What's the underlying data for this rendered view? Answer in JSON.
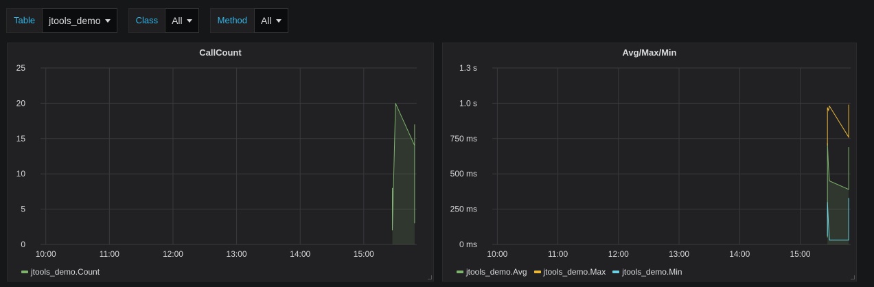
{
  "variables": [
    {
      "label": "Table",
      "value": "jtools_demo"
    },
    {
      "label": "Class",
      "value": "All"
    },
    {
      "label": "Method",
      "value": "All"
    }
  ],
  "colors": {
    "avg": "#7eb26d",
    "max": "#eab839",
    "min": "#6ed0e0",
    "grid": "#3a3a3d"
  },
  "chart_data": [
    {
      "type": "line",
      "title": "CallCount",
      "xticks": [
        "10:00",
        "11:00",
        "12:00",
        "13:00",
        "14:00",
        "15:00"
      ],
      "yticks": [
        "0",
        "5",
        "10",
        "15",
        "20",
        "25"
      ],
      "ylim": [
        0,
        25
      ],
      "xlim": [
        "09:55",
        "15:50"
      ],
      "grid": true,
      "legend_position": "bottom-left",
      "series": [
        {
          "name": "jtools_demo.Count",
          "color": "#7eb26d",
          "fill": true,
          "x": [
            "15:27",
            "15:27",
            "15:30",
            "15:48",
            "15:48",
            "15:48"
          ],
          "values": [
            8,
            2,
            20,
            14,
            3,
            17
          ]
        }
      ]
    },
    {
      "type": "line",
      "title": "Avg/Max/Min",
      "xticks": [
        "10:00",
        "11:00",
        "12:00",
        "13:00",
        "14:00",
        "15:00"
      ],
      "yticks": [
        "0 ms",
        "250 ms",
        "500 ms",
        "750 ms",
        "1.0 s",
        "1.3 s"
      ],
      "ylim": [
        0,
        1.25
      ],
      "xlim": [
        "09:55",
        "15:50"
      ],
      "grid": true,
      "legend_position": "bottom-left",
      "series": [
        {
          "name": "jtools_demo.Avg",
          "color": "#7eb26d",
          "fill": true,
          "x": [
            "15:27",
            "15:27",
            "15:28",
            "15:29",
            "15:48",
            "15:48"
          ],
          "values": [
            0.05,
            0.72,
            0.55,
            0.45,
            0.39,
            0.69
          ]
        },
        {
          "name": "jtools_demo.Max",
          "color": "#eab839",
          "fill": false,
          "x": [
            "15:27",
            "15:27",
            "15:28",
            "15:29",
            "15:48",
            "15:48"
          ],
          "values": [
            0.7,
            0.97,
            0.95,
            0.98,
            0.76,
            0.99
          ]
        },
        {
          "name": "jtools_demo.Min",
          "color": "#6ed0e0",
          "fill": false,
          "x": [
            "15:27",
            "15:27",
            "15:28",
            "15:29",
            "15:48",
            "15:48"
          ],
          "values": [
            0.06,
            0.3,
            0.15,
            0.03,
            0.03,
            0.33
          ]
        }
      ]
    }
  ]
}
